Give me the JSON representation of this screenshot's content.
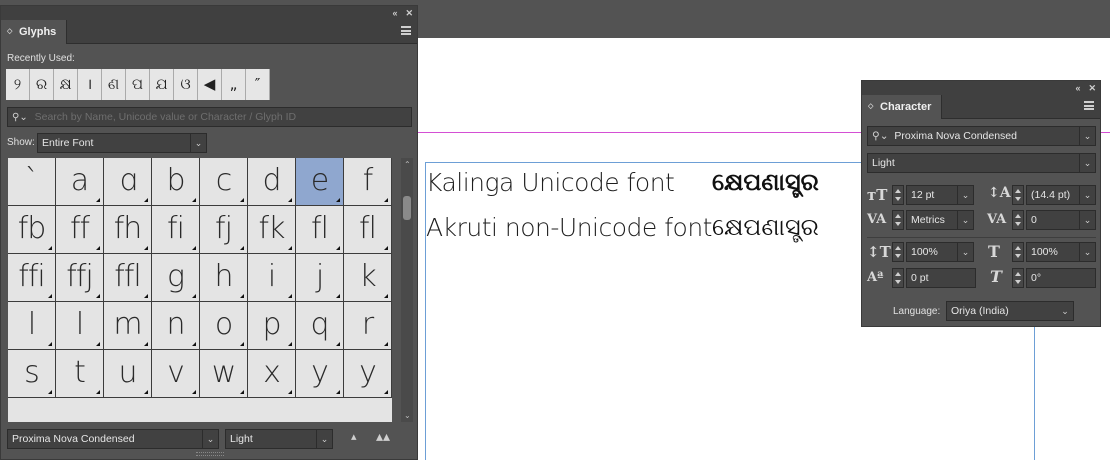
{
  "glyphs_panel": {
    "title": "Glyphs",
    "recently_used_label": "Recently Used:",
    "recent_glyphs": [
      "୨",
      "ର",
      "କ୍ଷ",
      "।",
      "ଣ",
      "ପ",
      "ଯ",
      "ଓ",
      "◀",
      "„",
      "″"
    ],
    "search_placeholder": "Search by Name, Unicode value or Character / Glyph ID",
    "show_label": "Show:",
    "show_value": "Entire Font",
    "grid_glyphs": [
      "`",
      "a",
      "ɑ",
      "b",
      "c",
      "d",
      "e",
      "f",
      "fb",
      "ff",
      "fh",
      "fi",
      "fj",
      "fk",
      "fl",
      "fl",
      "ffi",
      "ffj",
      "ffl",
      "g",
      "h",
      "i",
      "j",
      "k",
      "l",
      "l",
      "m",
      "n",
      "o",
      "p",
      "q",
      "r",
      "s",
      "t",
      "u",
      "v",
      "w",
      "x",
      "y",
      "y"
    ],
    "selected_glyph": "e",
    "font_family": "Proxima Nova Condensed",
    "font_style": "Light"
  },
  "document": {
    "line1_label": "Kalinga Unicode font",
    "line1_sample": "କ୍ଷେପଣାସ୍ତ୍ର",
    "line2_label": "Akruti non-Unicode font",
    "line2_sample": "କ୍ଷେପଣାସ୍ତ୍ର"
  },
  "character_panel": {
    "title": "Character",
    "font_family": "Proxima Nova Condensed",
    "font_style": "Light",
    "font_size": "12 pt",
    "leading": "(14.4 pt)",
    "kerning": "Metrics",
    "tracking": "0",
    "vertical_scale": "100%",
    "horizontal_scale": "100%",
    "baseline_shift": "0 pt",
    "skew": "0°",
    "language_label": "Language:",
    "language_value": "Oriya (India)"
  },
  "colors": {
    "panel_bg": "#535353",
    "selected_glyph_bg": "#8fa7cf",
    "guide_magenta": "#d44fd4",
    "frame_blue": "#6d9fd6"
  }
}
